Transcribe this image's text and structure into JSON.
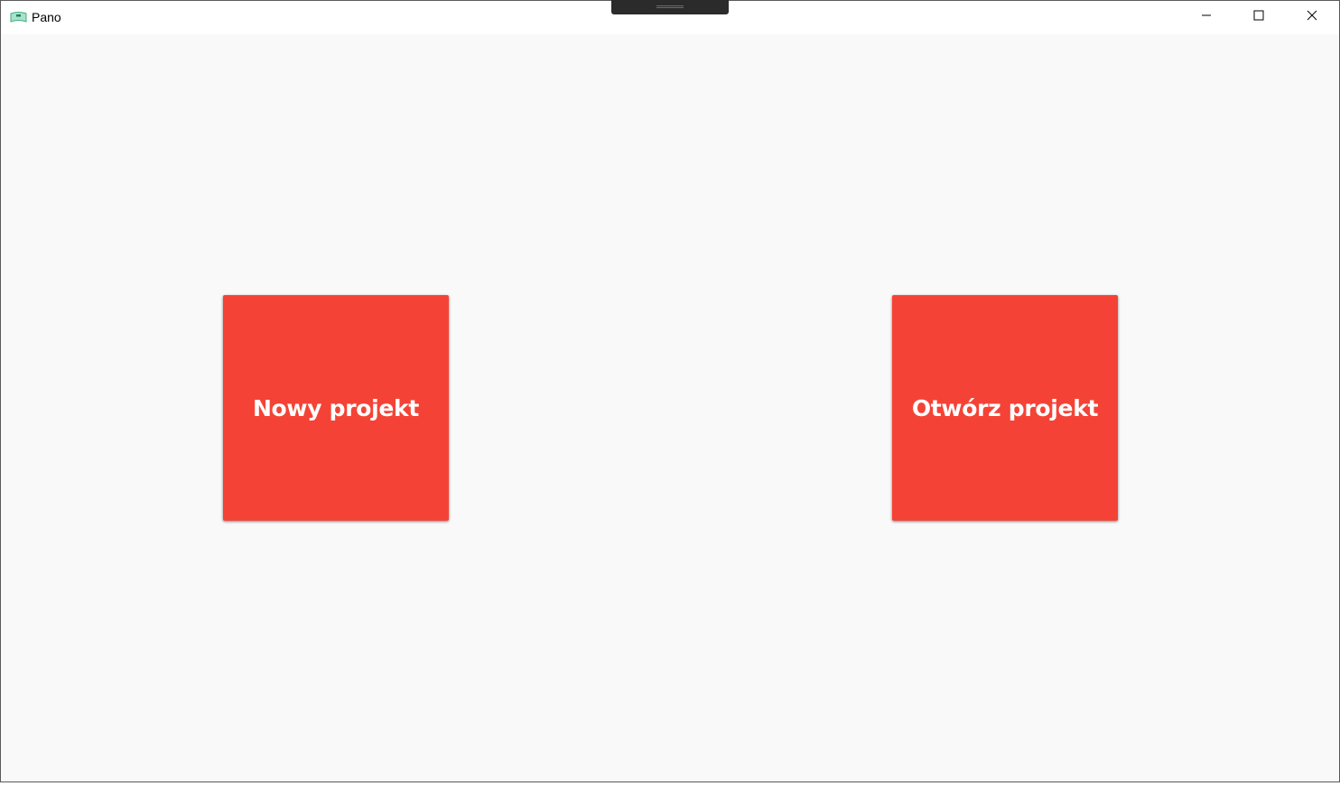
{
  "window": {
    "title": "Pano",
    "app_icon": "pano-360-icon",
    "controls": {
      "minimize_icon": "minimize-icon",
      "maximize_icon": "maximize-icon",
      "close_icon": "close-icon"
    }
  },
  "main": {
    "tiles": [
      {
        "label": "Nowy projekt",
        "color": "#f44336"
      },
      {
        "label": "Otwórz projekt",
        "color": "#f44336"
      }
    ]
  },
  "colors": {
    "background": "#f9f9f9",
    "accent": "#f44336",
    "tile_text": "#ffffff"
  }
}
